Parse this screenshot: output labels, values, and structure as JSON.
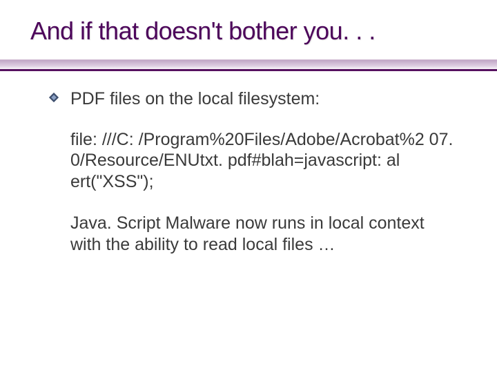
{
  "slide": {
    "title": "And if that doesn't bother you. . .",
    "bullet1": "PDF files on the local filesystem:",
    "code": "file: ///C: /Program%20Files/Adobe/Acrobat%2 07. 0/Resource/ENUtxt. pdf#blah=javascript: al ert(\"XSS\");",
    "note": "Java. Script Malware now runs in local context with the ability to read local files …"
  }
}
